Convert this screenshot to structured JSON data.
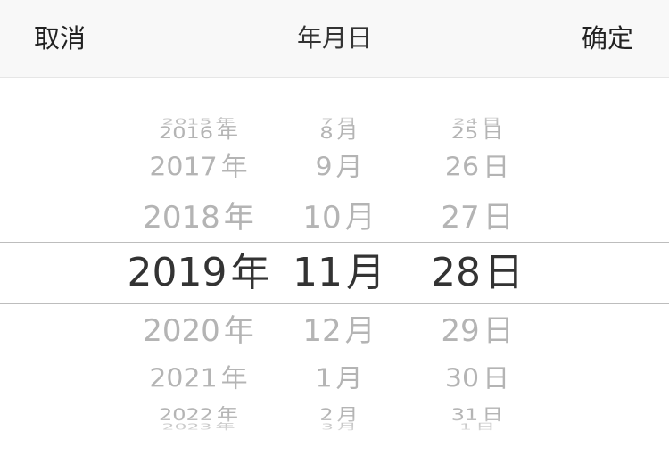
{
  "toolbar": {
    "cancel_label": "取消",
    "title": "年月日",
    "confirm_label": "确定"
  },
  "picker": {
    "year": {
      "suffix": "年",
      "items": [
        "2015",
        "2016",
        "2017",
        "2018",
        "2019",
        "2020",
        "2021",
        "2022",
        "2023"
      ],
      "selected_index": 4
    },
    "month": {
      "suffix": "月",
      "items": [
        "7",
        "8",
        "9",
        "10",
        "11",
        "12",
        "1",
        "2",
        "3"
      ],
      "selected_index": 4
    },
    "day": {
      "suffix": "日",
      "items": [
        "24",
        "25",
        "26",
        "27",
        "28",
        "29",
        "30",
        "31",
        "1"
      ],
      "selected_index": 4
    }
  },
  "colors": {
    "toolbar_bg": "#f8f8f8",
    "selected_text": "#333333",
    "unselected_text": "#b4b4b4",
    "divider": "#bdbdbd"
  }
}
